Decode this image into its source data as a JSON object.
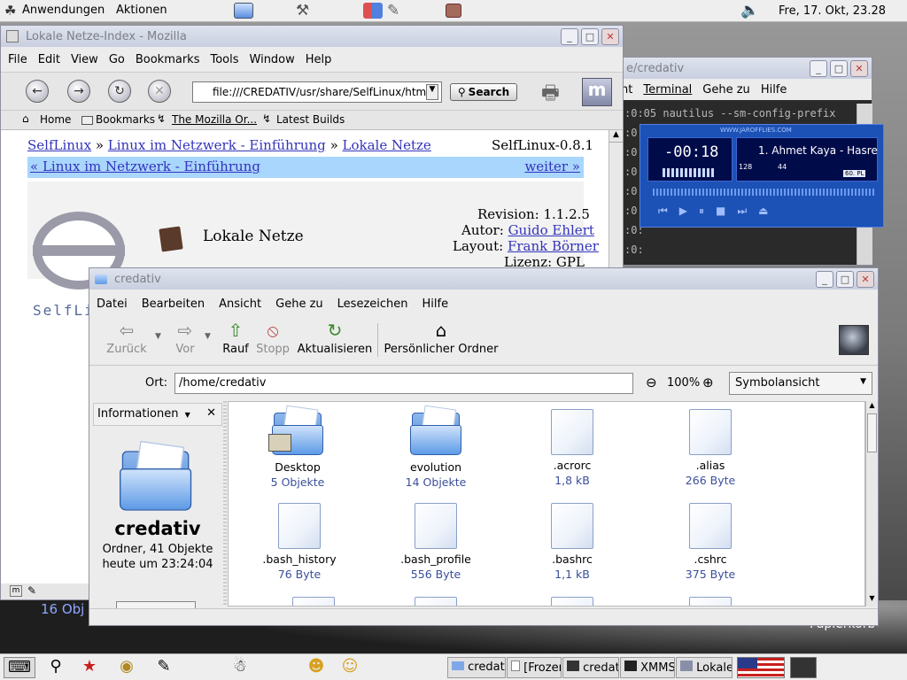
{
  "top_panel": {
    "menus": [
      "Anwendungen",
      "Aktionen"
    ],
    "clock": "Fre, 17. Okt, 23.28"
  },
  "desktop": {
    "label_left": "16 Obj",
    "label_right": "Papierkorb"
  },
  "terminal": {
    "title": "e/credativ",
    "menus": [
      "nt",
      "Terminal",
      "Gehe zu",
      "Hilfe"
    ],
    "lines": [
      ":0:05 nautilus --sm-config-prefix",
      ":0:",
      ":0:",
      ":0:",
      ":0:",
      ":0:",
      ":0:",
      ":0:"
    ]
  },
  "xmms": {
    "brand": "WWW.JAROFFLIES.COM",
    "time": "-00:18",
    "song": "1. Ahmet Kaya - Hasre",
    "kbps": "128",
    "khz": "44",
    "badge": "60. PL"
  },
  "mozilla": {
    "title": "Lokale Netze-Index - Mozilla",
    "menus": [
      "File",
      "Edit",
      "View",
      "Go",
      "Bookmarks",
      "Tools",
      "Window",
      "Help"
    ],
    "url": "file:///CREDATIV/usr/share/SelfLinux/html/l",
    "search_label": "Search",
    "bookmarks": [
      "Home",
      "Bookmarks",
      "The Mozilla Or...",
      "Latest Builds"
    ],
    "page": {
      "crumbs": [
        "SelfLinux",
        "Linux im Netzwerk - Einführung",
        "Lokale Netze"
      ],
      "crumb_sep": "»",
      "version": "SelfLinux-0.8.1",
      "prev_link": "« Linux im Netzwerk - Einführung",
      "next_link": "weiter »",
      "logo_text": "SelfLi",
      "heading": "Lokale Netze",
      "revision_label": "Revision: 1.1.2.5",
      "author_label": "Autor:",
      "author": "Guido Ehlert",
      "layout_label": "Layout:",
      "layout": "Frank Börner",
      "license": "Lizenz: GPL"
    }
  },
  "nautilus": {
    "title": "credativ",
    "menus": [
      "Datei",
      "Bearbeiten",
      "Ansicht",
      "Gehe zu",
      "Lesezeichen",
      "Hilfe"
    ],
    "toolbar": {
      "back": "Zurück",
      "forward": "Vor",
      "up": "Rauf",
      "stop": "Stopp",
      "reload": "Aktualisieren",
      "home": "Persönlicher Ordner"
    },
    "location_label": "Ort:",
    "location": "/home/credativ",
    "zoom": "100%",
    "view_mode": "Symbolansicht",
    "sidebar": {
      "header": "Informationen",
      "folder_name": "credativ",
      "summary": "Ordner, 41 Objekte",
      "modified": "heute um 23:24:04"
    },
    "files": [
      {
        "name": "Desktop",
        "info": "5 Objekte"
      },
      {
        "name": "evolution",
        "info": "14 Objekte"
      },
      {
        "name": ".acrorc",
        "info": "1,8 kB"
      },
      {
        "name": ".alias",
        "info": "266 Byte"
      },
      {
        "name": ".bash_history",
        "info": "76 Byte"
      },
      {
        "name": ".bash_profile",
        "info": "556 Byte"
      },
      {
        "name": ".bashrc",
        "info": "1,1 kB"
      },
      {
        "name": ".cshrc",
        "info": "375 Byte"
      }
    ]
  },
  "taskbar": {
    "tasks": [
      "credat",
      "[Frozer",
      "credati",
      "XMMS",
      "Lokale"
    ]
  }
}
